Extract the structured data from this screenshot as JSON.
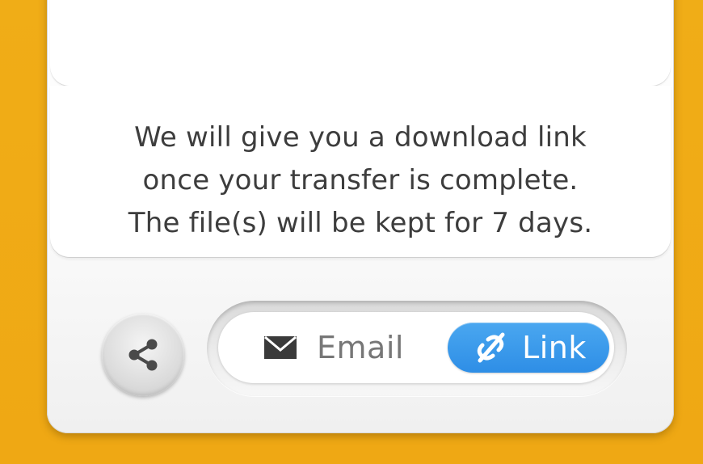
{
  "info": {
    "line1": "We will give you a download link",
    "line2": "once your transfer is complete.",
    "line3": "The file(s) will be kept for 7 days."
  },
  "toggle": {
    "email_label": "Email",
    "link_label": "Link",
    "selected": "Link"
  },
  "icons": {
    "share": "share-icon",
    "email": "envelope-icon",
    "link": "link-icon"
  },
  "colors": {
    "background": "#f0ad17",
    "accent": "#3a9aec",
    "text": "#3d3d3d",
    "muted_text": "#777777"
  }
}
